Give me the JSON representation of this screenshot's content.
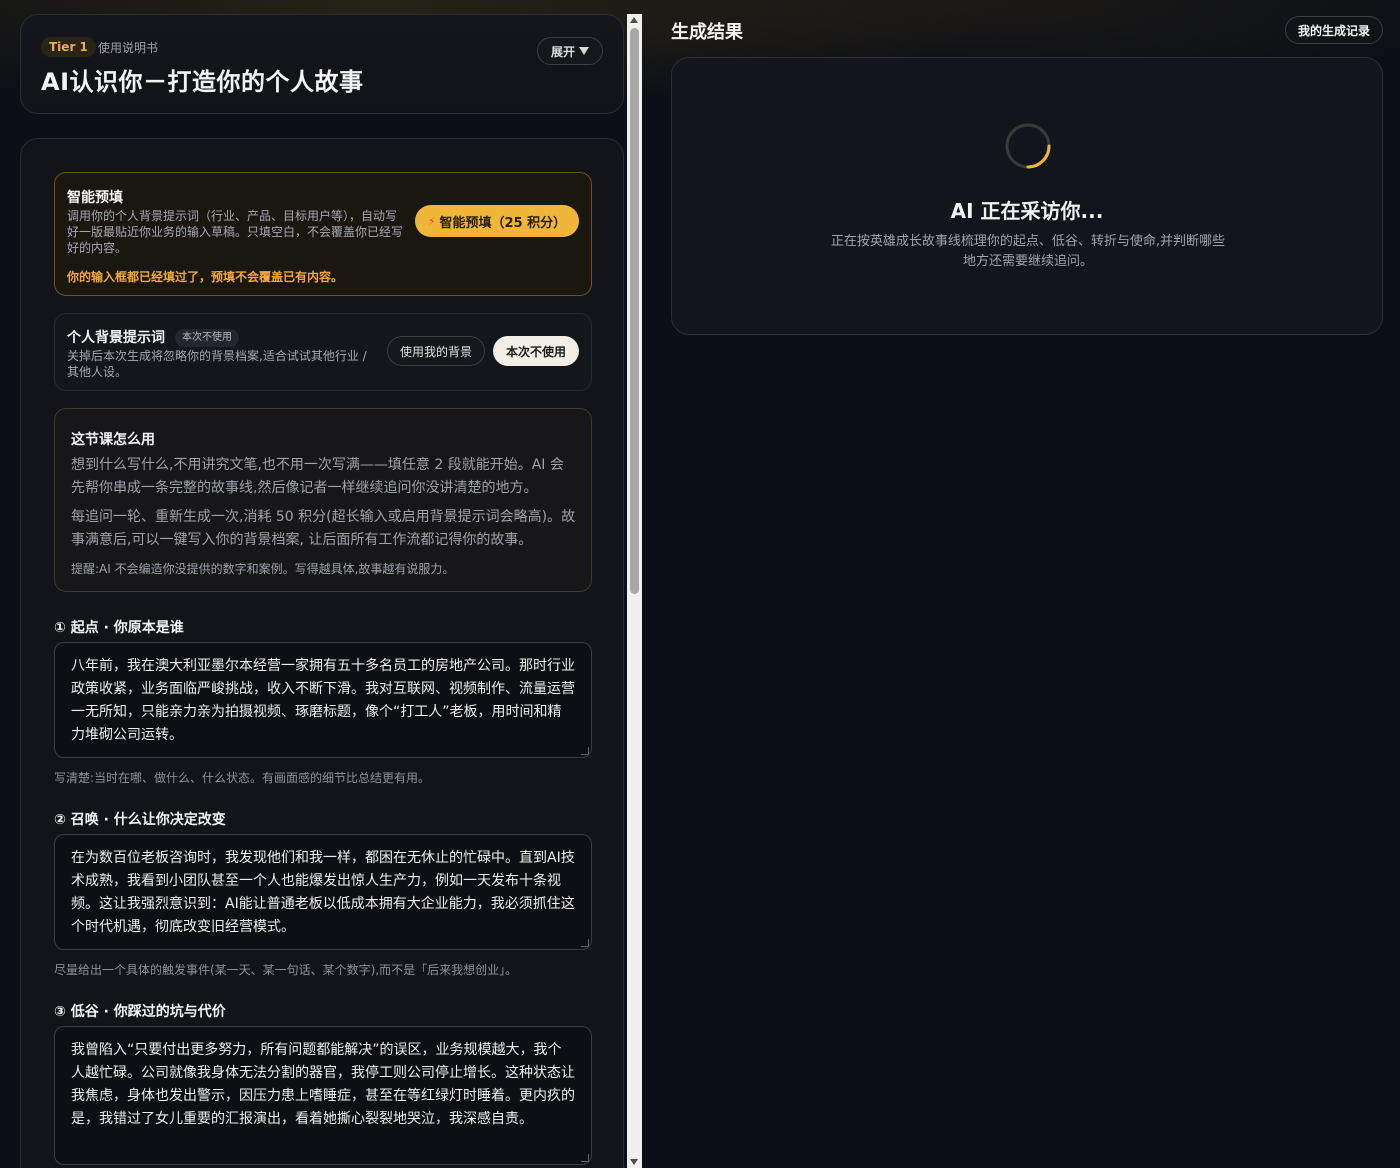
{
  "header": {
    "tier": "Tier 1",
    "manual": "使用说明书",
    "title": "AI认识你－打造你的个人故事",
    "expand_label": "展开"
  },
  "prefill": {
    "title": "智能预填",
    "description": "调用你的个人背景提示词（行业、产品、目标用户等），自动写好一版最贴近你业务的输入草稿。只填空白，不会覆盖你已经写好的内容。",
    "warning": "你的输入框都已经填过了，预填不会覆盖已有内容。",
    "button_label": "智能预填（25 积分）",
    "button_icon": "lightning-icon"
  },
  "background": {
    "title": "个人背景提示词",
    "tag": "本次不使用",
    "description": "关掉后本次生成将忽略你的背景档案,适合试试其他行业 / 其他人设。",
    "use_label": "使用我的背景",
    "skip_label": "本次不使用"
  },
  "howto": {
    "title": "这节课怎么用",
    "p1": "想到什么写什么,不用讲究文笔,也不用一次写满——填任意 2 段就能开始。AI 会先帮你串成一条完整的故事线,然后像记者一样继续追问你没讲清楚的地方。",
    "p2": "每追问一轮、重新生成一次,消耗 50 积分(超长输入或启用背景提示词会略高)。故事满意后,可以一键写入你的背景档案, 让后面所有工作流都记得你的故事。",
    "tip": "提醒:AI 不会编造你没提供的数字和案例。写得越具体,故事越有说服力。"
  },
  "questions": [
    {
      "label": "① 起点 · 你原本是谁",
      "value": "八年前，我在澳大利亚墨尔本经营一家拥有五十多名员工的房地产公司。那时行业政策收紧，业务面临严峻挑战，收入不断下滑。我对互联网、视频制作、流量运营一无所知，只能亲力亲为拍摄视频、琢磨标题，像个“打工人”老板，用时间和精力堆砌公司运转。",
      "hint": "写清楚:当时在哪、做什么、什么状态。有画面感的细节比总结更有用。"
    },
    {
      "label": "② 召唤 · 什么让你决定改变",
      "value": "在为数百位老板咨询时，我发现他们和我一样，都困在无休止的忙碌中。直到AI技术成熟，我看到小团队甚至一个人也能爆发出惊人生产力，例如一天发布十条视频。这让我强烈意识到：AI能让普通老板以低成本拥有大企业能力，我必须抓住这个时代机遇，彻底改变旧经营模式。",
      "hint": "尽量给出一个具体的触发事件(某一天、某一句话、某个数字),而不是「后来我想创业」。"
    },
    {
      "label": "③ 低谷 · 你踩过的坑与代价",
      "value": "我曾陷入“只要付出更多努力，所有问题都能解决”的误区，业务规模越大，我个人越忙碌。公司就像我身体无法分割的器官，我停工则公司停止增长。这种状态让我焦虑，身体也发出警示，因压力患上嗜睡症，甚至在等红绿灯时睡着。更内疚的是，我错过了女儿重要的汇报演出，看着她撕心裂裂地哭泣，我深感自责。",
      "hint": ""
    }
  ],
  "result": {
    "title": "生成结果",
    "history_label": "我的生成记录",
    "loading_title": "AI 正在采访你...",
    "loading_desc": "正在按英雄成长故事线梳理你的起点、低谷、转折与使命,并判断哪些地方还需要继续追问。"
  },
  "colors": {
    "accent": "#f0b63a",
    "warning": "#f0a93a",
    "background": "#0c0f16"
  }
}
